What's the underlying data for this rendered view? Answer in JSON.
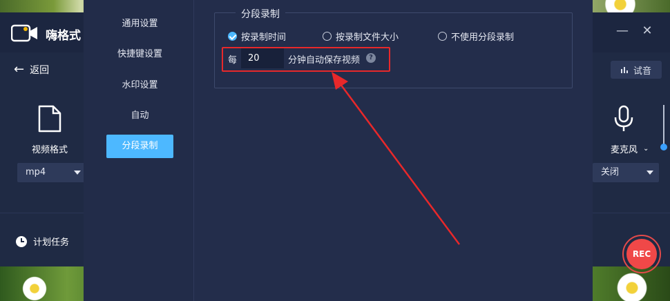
{
  "app": {
    "title": "嗨格式",
    "back_label": "返回",
    "try_audio_label": "试音",
    "format": {
      "label": "视频格式",
      "value": "mp4"
    },
    "microphone": {
      "label": "麦克风",
      "value": "关闭"
    },
    "schedule_label": "计划任务",
    "rec_label": "REC",
    "window_minimize": "—",
    "window_close": "✕"
  },
  "settings": {
    "menu": [
      {
        "label": "通用设置",
        "active": false
      },
      {
        "label": "快捷键设置",
        "active": false
      },
      {
        "label": "水印设置",
        "active": false
      },
      {
        "label": "自动",
        "active": false
      },
      {
        "label": "分段录制",
        "active": true
      }
    ],
    "segment": {
      "title": "分段录制",
      "options": [
        {
          "label": "按录制时间",
          "checked": true
        },
        {
          "label": "按录制文件大小",
          "checked": false
        },
        {
          "label": "不使用分段录制",
          "checked": false
        }
      ],
      "every_label": "每",
      "minutes_value": "20",
      "autosave_label": "分钟自动保存视频",
      "help_glyph": "?"
    }
  },
  "colors": {
    "accent": "#4db8ff",
    "annotation_red": "#e8282a",
    "rec_red": "#f04848",
    "dialog_bg": "#232d4b"
  }
}
